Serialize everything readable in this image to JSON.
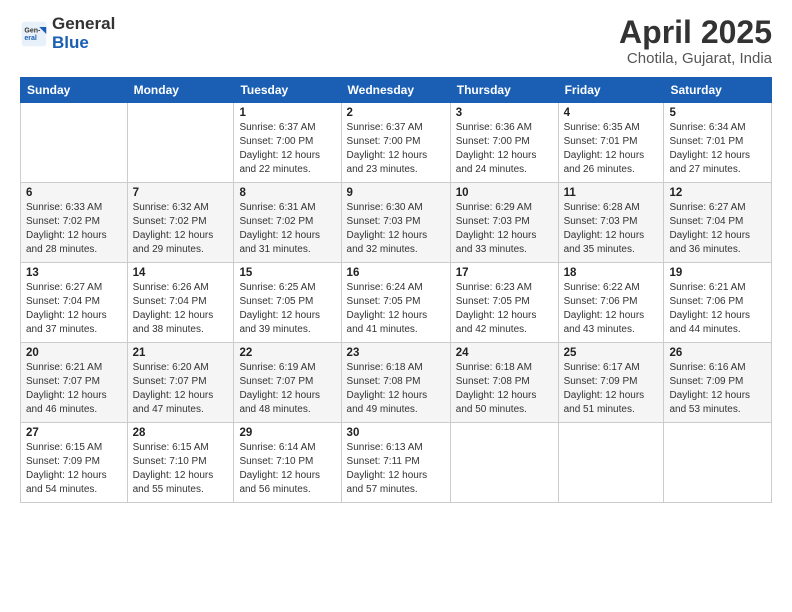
{
  "header": {
    "logo_line1": "General",
    "logo_line2": "Blue",
    "month": "April 2025",
    "location": "Chotila, Gujarat, India"
  },
  "weekdays": [
    "Sunday",
    "Monday",
    "Tuesday",
    "Wednesday",
    "Thursday",
    "Friday",
    "Saturday"
  ],
  "weeks": [
    [
      {
        "day": "",
        "info": ""
      },
      {
        "day": "",
        "info": ""
      },
      {
        "day": "1",
        "info": "Sunrise: 6:37 AM\nSunset: 7:00 PM\nDaylight: 12 hours and 22 minutes."
      },
      {
        "day": "2",
        "info": "Sunrise: 6:37 AM\nSunset: 7:00 PM\nDaylight: 12 hours and 23 minutes."
      },
      {
        "day": "3",
        "info": "Sunrise: 6:36 AM\nSunset: 7:00 PM\nDaylight: 12 hours and 24 minutes."
      },
      {
        "day": "4",
        "info": "Sunrise: 6:35 AM\nSunset: 7:01 PM\nDaylight: 12 hours and 26 minutes."
      },
      {
        "day": "5",
        "info": "Sunrise: 6:34 AM\nSunset: 7:01 PM\nDaylight: 12 hours and 27 minutes."
      }
    ],
    [
      {
        "day": "6",
        "info": "Sunrise: 6:33 AM\nSunset: 7:02 PM\nDaylight: 12 hours and 28 minutes."
      },
      {
        "day": "7",
        "info": "Sunrise: 6:32 AM\nSunset: 7:02 PM\nDaylight: 12 hours and 29 minutes."
      },
      {
        "day": "8",
        "info": "Sunrise: 6:31 AM\nSunset: 7:02 PM\nDaylight: 12 hours and 31 minutes."
      },
      {
        "day": "9",
        "info": "Sunrise: 6:30 AM\nSunset: 7:03 PM\nDaylight: 12 hours and 32 minutes."
      },
      {
        "day": "10",
        "info": "Sunrise: 6:29 AM\nSunset: 7:03 PM\nDaylight: 12 hours and 33 minutes."
      },
      {
        "day": "11",
        "info": "Sunrise: 6:28 AM\nSunset: 7:03 PM\nDaylight: 12 hours and 35 minutes."
      },
      {
        "day": "12",
        "info": "Sunrise: 6:27 AM\nSunset: 7:04 PM\nDaylight: 12 hours and 36 minutes."
      }
    ],
    [
      {
        "day": "13",
        "info": "Sunrise: 6:27 AM\nSunset: 7:04 PM\nDaylight: 12 hours and 37 minutes."
      },
      {
        "day": "14",
        "info": "Sunrise: 6:26 AM\nSunset: 7:04 PM\nDaylight: 12 hours and 38 minutes."
      },
      {
        "day": "15",
        "info": "Sunrise: 6:25 AM\nSunset: 7:05 PM\nDaylight: 12 hours and 39 minutes."
      },
      {
        "day": "16",
        "info": "Sunrise: 6:24 AM\nSunset: 7:05 PM\nDaylight: 12 hours and 41 minutes."
      },
      {
        "day": "17",
        "info": "Sunrise: 6:23 AM\nSunset: 7:05 PM\nDaylight: 12 hours and 42 minutes."
      },
      {
        "day": "18",
        "info": "Sunrise: 6:22 AM\nSunset: 7:06 PM\nDaylight: 12 hours and 43 minutes."
      },
      {
        "day": "19",
        "info": "Sunrise: 6:21 AM\nSunset: 7:06 PM\nDaylight: 12 hours and 44 minutes."
      }
    ],
    [
      {
        "day": "20",
        "info": "Sunrise: 6:21 AM\nSunset: 7:07 PM\nDaylight: 12 hours and 46 minutes."
      },
      {
        "day": "21",
        "info": "Sunrise: 6:20 AM\nSunset: 7:07 PM\nDaylight: 12 hours and 47 minutes."
      },
      {
        "day": "22",
        "info": "Sunrise: 6:19 AM\nSunset: 7:07 PM\nDaylight: 12 hours and 48 minutes."
      },
      {
        "day": "23",
        "info": "Sunrise: 6:18 AM\nSunset: 7:08 PM\nDaylight: 12 hours and 49 minutes."
      },
      {
        "day": "24",
        "info": "Sunrise: 6:18 AM\nSunset: 7:08 PM\nDaylight: 12 hours and 50 minutes."
      },
      {
        "day": "25",
        "info": "Sunrise: 6:17 AM\nSunset: 7:09 PM\nDaylight: 12 hours and 51 minutes."
      },
      {
        "day": "26",
        "info": "Sunrise: 6:16 AM\nSunset: 7:09 PM\nDaylight: 12 hours and 53 minutes."
      }
    ],
    [
      {
        "day": "27",
        "info": "Sunrise: 6:15 AM\nSunset: 7:09 PM\nDaylight: 12 hours and 54 minutes."
      },
      {
        "day": "28",
        "info": "Sunrise: 6:15 AM\nSunset: 7:10 PM\nDaylight: 12 hours and 55 minutes."
      },
      {
        "day": "29",
        "info": "Sunrise: 6:14 AM\nSunset: 7:10 PM\nDaylight: 12 hours and 56 minutes."
      },
      {
        "day": "30",
        "info": "Sunrise: 6:13 AM\nSunset: 7:11 PM\nDaylight: 12 hours and 57 minutes."
      },
      {
        "day": "",
        "info": ""
      },
      {
        "day": "",
        "info": ""
      },
      {
        "day": "",
        "info": ""
      }
    ]
  ]
}
